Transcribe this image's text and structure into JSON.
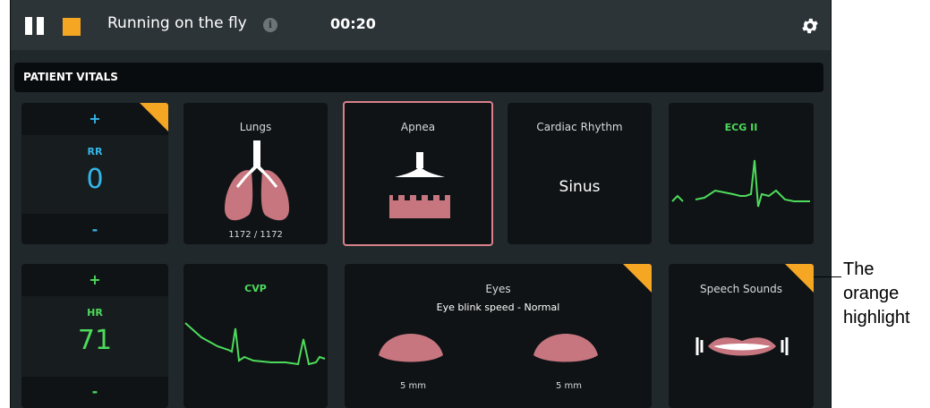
{
  "topbar": {
    "title": "Running on the fly",
    "info_glyph": "i",
    "timer": "00:20",
    "accent": "#f5a623"
  },
  "section": {
    "title": "PATIENT VITALS"
  },
  "vitals": {
    "rr": {
      "plus": "+",
      "label": "RR",
      "value": "0",
      "minus": "-",
      "color": "#35b6e8"
    },
    "hr": {
      "plus": "+",
      "label": "HR",
      "value": "71",
      "minus": "-",
      "color": "#4ddb5b"
    }
  },
  "cards": {
    "lungs": {
      "label": "Lungs",
      "sub": "1172 / 1172"
    },
    "apnea": {
      "label": "Apnea"
    },
    "cardiac": {
      "label": "Cardiac Rhythm",
      "value": "Sinus"
    },
    "ecg": {
      "label": "ECG II"
    },
    "cvp": {
      "label": "CVP"
    },
    "eyes": {
      "label": "Eyes",
      "sub": "Eye blink speed - Normal",
      "left": "5 mm",
      "right": "5 mm"
    },
    "speech": {
      "label": "Speech Sounds"
    }
  },
  "annotation": {
    "line1": "The",
    "line2": "orange",
    "line3": "highlight"
  }
}
